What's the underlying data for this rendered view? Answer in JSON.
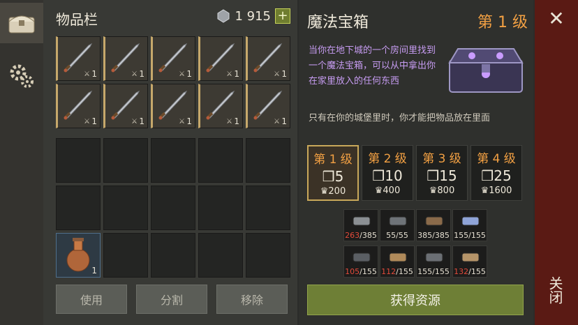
{
  "sidebar": {
    "tabs": [
      {
        "icon": "chest-icon",
        "active": true
      },
      {
        "icon": "gears-icon",
        "active": false
      }
    ]
  },
  "inventory": {
    "title": "物品栏",
    "currency_icon": "gem-icon",
    "currency_amount": "1 915",
    "add_label": "+",
    "weapon_slots": [
      {
        "count": "1",
        "sub": "⚔"
      },
      {
        "count": "1",
        "sub": "⚔"
      },
      {
        "count": "1",
        "sub": "⚔"
      },
      {
        "count": "1",
        "sub": "⚔"
      },
      {
        "count": "1",
        "sub": "⚔"
      },
      {
        "count": "1",
        "sub": "⚔"
      },
      {
        "count": "1",
        "sub": "⚔"
      },
      {
        "count": "1",
        "sub": "⚔"
      },
      {
        "count": "1",
        "sub": "⚔"
      },
      {
        "count": "1",
        "sub": "⚔"
      }
    ],
    "storage_slots": [
      {
        "item": ""
      },
      {
        "item": ""
      },
      {
        "item": ""
      },
      {
        "item": ""
      },
      {
        "item": ""
      },
      {
        "item": ""
      },
      {
        "item": ""
      },
      {
        "item": ""
      },
      {
        "item": ""
      },
      {
        "item": ""
      },
      {
        "item": "flask-icon",
        "count": "1"
      },
      {
        "item": ""
      },
      {
        "item": ""
      },
      {
        "item": ""
      },
      {
        "item": ""
      }
    ],
    "buttons": {
      "use": "使用",
      "split": "分割",
      "remove": "移除"
    }
  },
  "detail": {
    "title": "魔法宝箱",
    "level": "第 1 级",
    "description": "当你在地下城的一个房间里找到一个魔法宝箱，可以从中拿出你在家里放入的任何东西",
    "note": "只有在你的城堡里时，你才能把物品放在里面",
    "levels": [
      {
        "title": "第 1 级",
        "cubes": "5",
        "cost": "200",
        "active": true
      },
      {
        "title": "第 2 级",
        "cubes": "10",
        "cost": "400",
        "active": false
      },
      {
        "title": "第 3 级",
        "cubes": "15",
        "cost": "800",
        "active": false
      },
      {
        "title": "第 4 级",
        "cubes": "25",
        "cost": "1600",
        "active": false
      }
    ],
    "resources": [
      {
        "icon": "chain-icon",
        "have": "263",
        "need": "385",
        "short": true
      },
      {
        "icon": "iron-bars-icon",
        "have": "55",
        "need": "55",
        "short": false
      },
      {
        "icon": "tools-icon",
        "have": "385",
        "need": "385",
        "short": false
      },
      {
        "icon": "crystal-icon",
        "have": "155",
        "need": "155",
        "short": false
      },
      {
        "icon": "ingot-icon",
        "have": "105",
        "need": "155",
        "short": true
      },
      {
        "icon": "plank-icon",
        "have": "112",
        "need": "155",
        "short": true
      },
      {
        "icon": "stone-bar-icon",
        "have": "155",
        "need": "155",
        "short": false
      },
      {
        "icon": "board-icon",
        "have": "132",
        "need": "155",
        "short": true
      }
    ],
    "get_button": "获得资源"
  },
  "close": {
    "label": "关闭",
    "icon": "close-icon"
  }
}
